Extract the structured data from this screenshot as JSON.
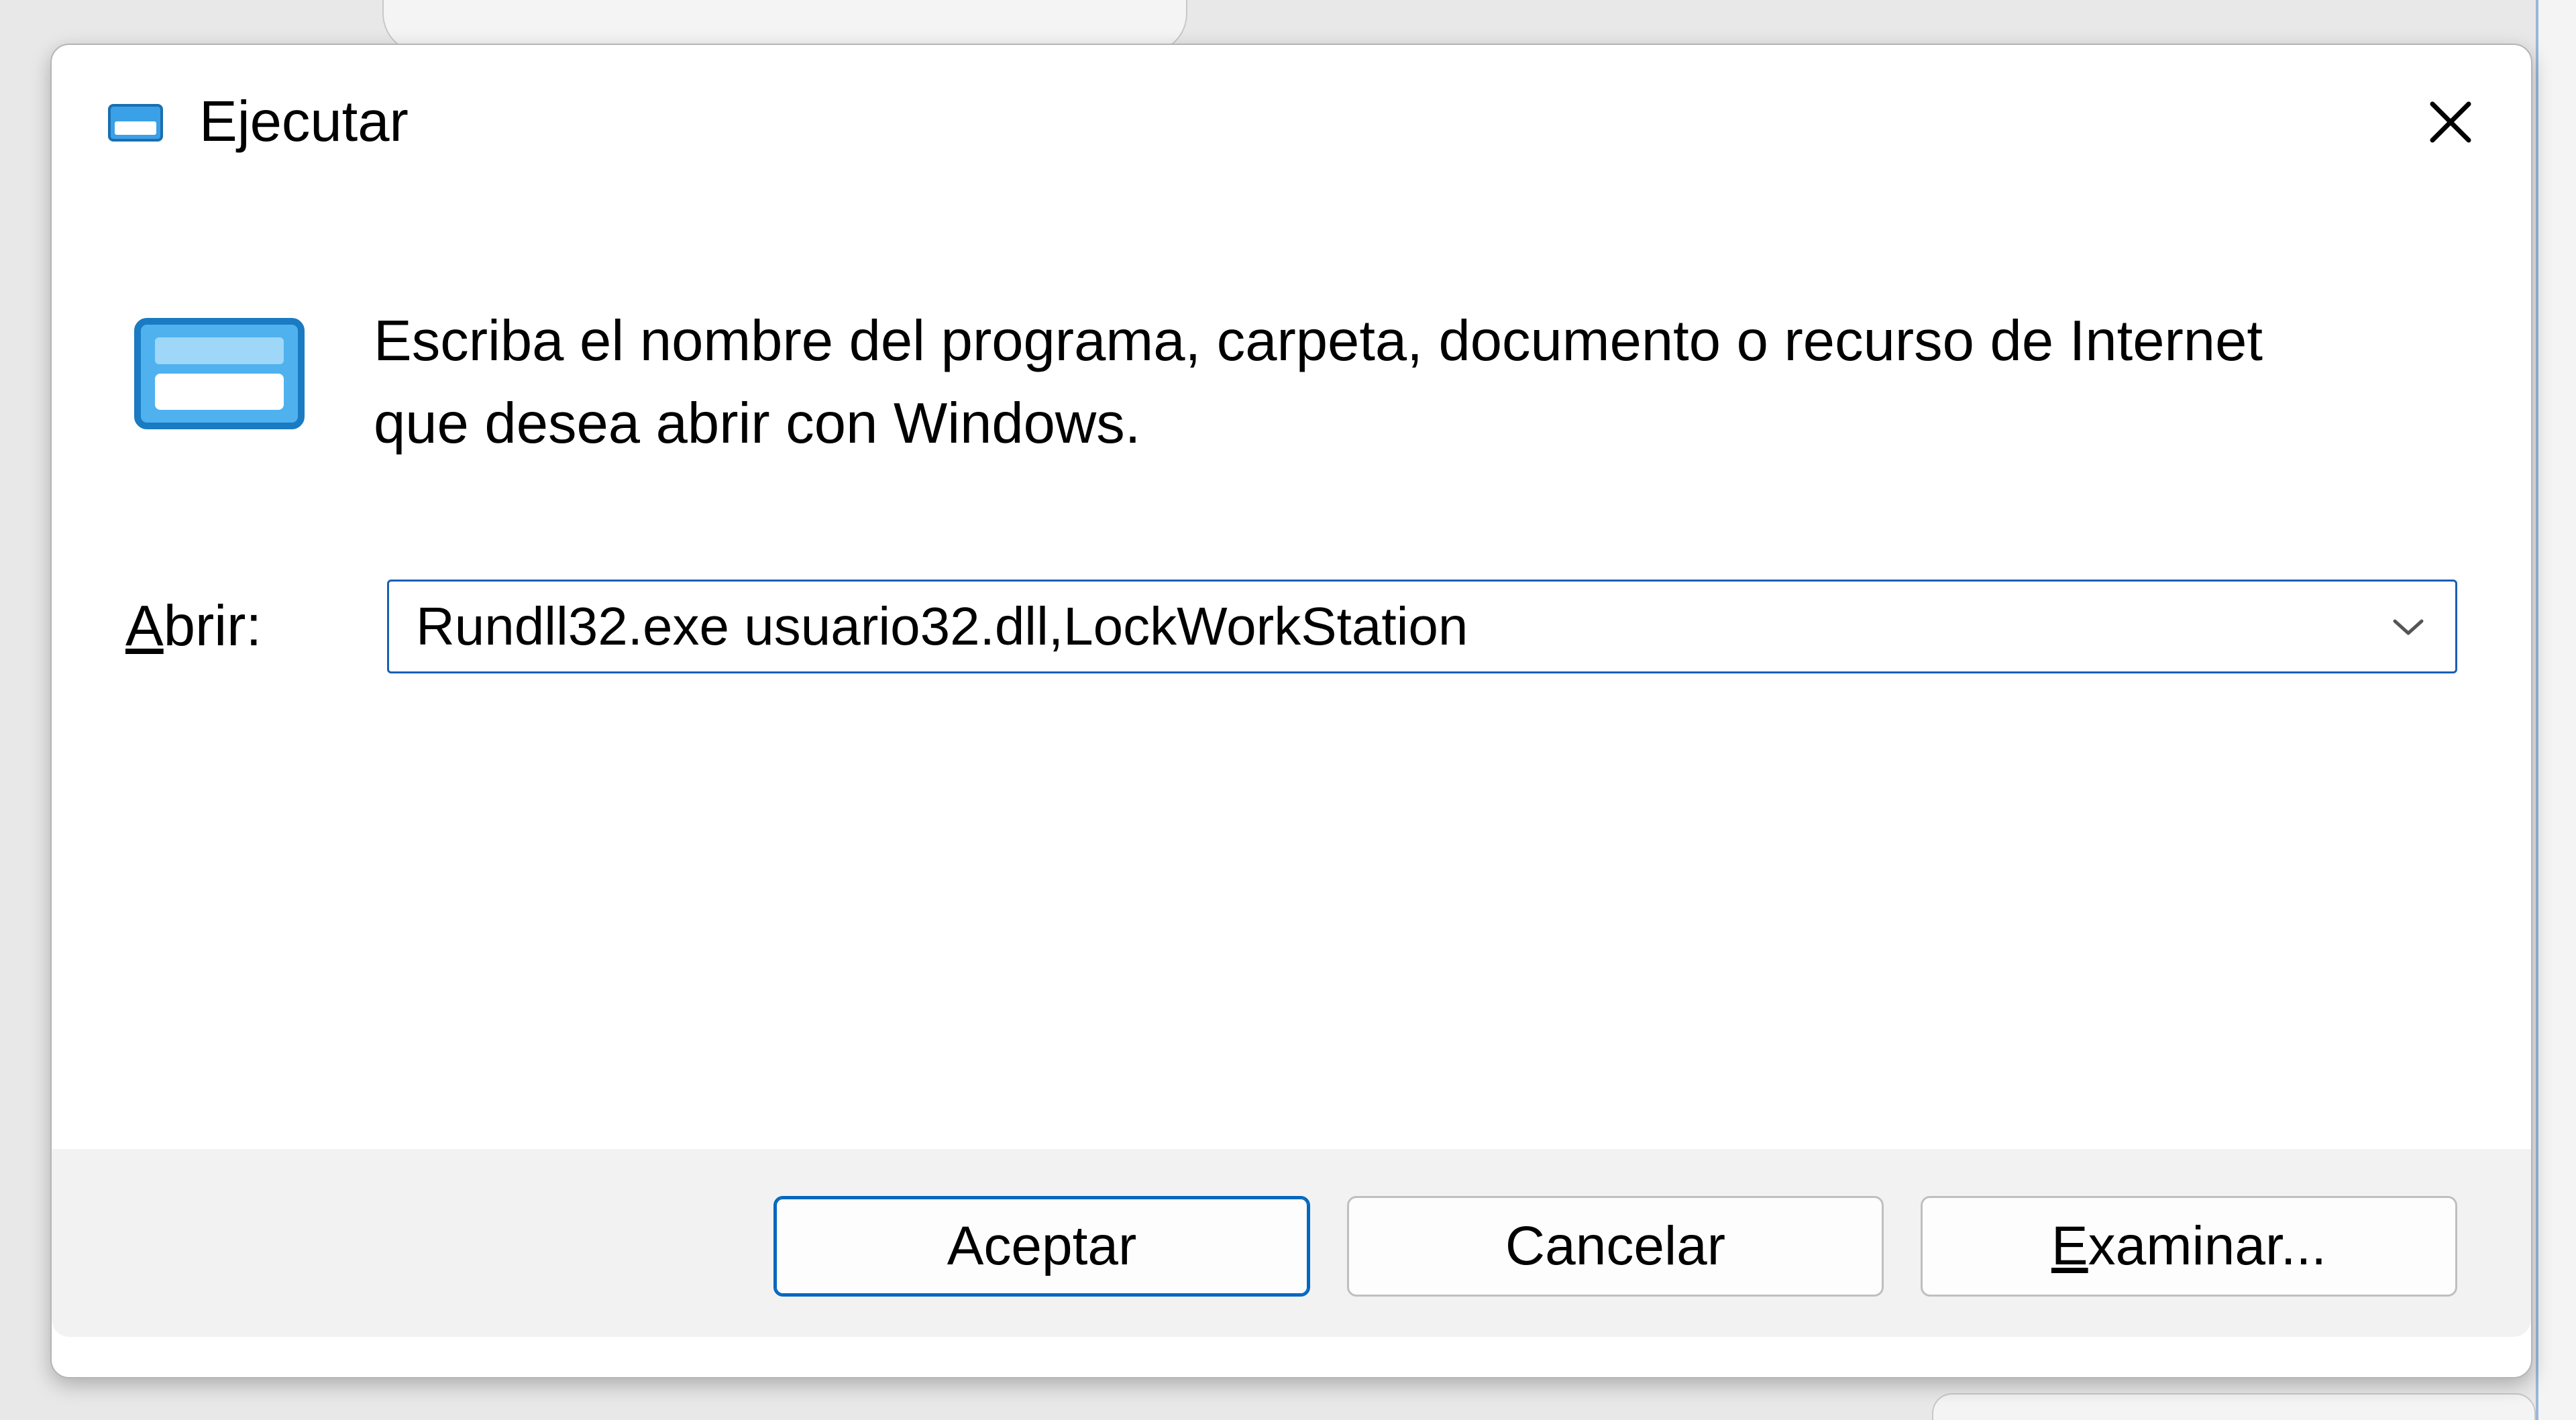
{
  "dialog": {
    "title": "Ejecutar",
    "description": "Escriba el nombre del programa, carpeta, documento o recurso de Internet que desea abrir con Windows.",
    "open_label_prefix": "A",
    "open_label_rest": "brir:",
    "command_value": "Rundll32.exe usuario32.dll,LockWorkStation",
    "buttons": {
      "ok": "Aceptar",
      "cancel": "Cancelar",
      "browse_prefix": "E",
      "browse_rest": "xaminar..."
    }
  }
}
